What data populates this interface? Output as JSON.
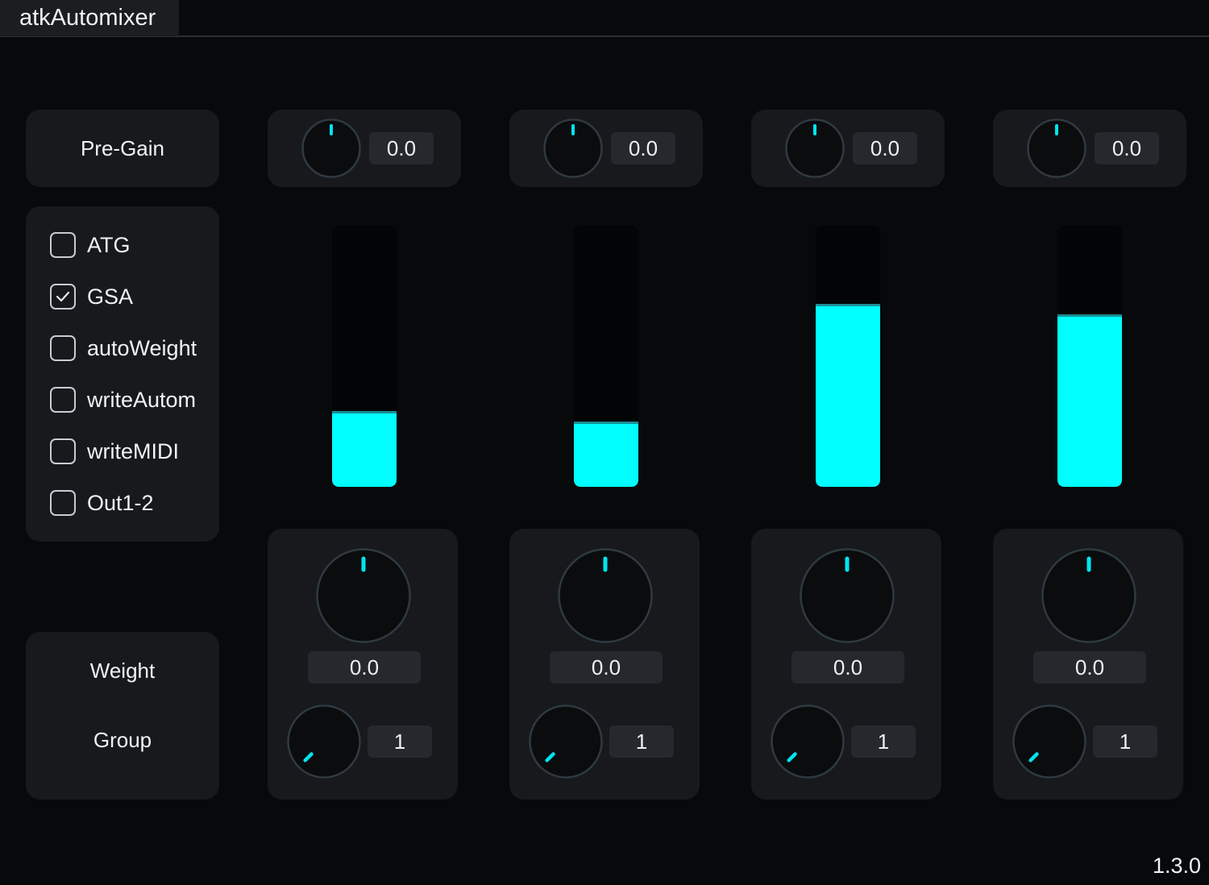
{
  "window": {
    "title": "atkAutomixer"
  },
  "labels": {
    "pregain": "Pre-Gain",
    "weight": "Weight",
    "group": "Group"
  },
  "options": [
    {
      "label": "ATG",
      "checked": false
    },
    {
      "label": "GSA",
      "checked": true
    },
    {
      "label": "autoWeight",
      "checked": false
    },
    {
      "label": "writeAutom",
      "checked": false
    },
    {
      "label": "writeMIDI",
      "checked": false
    },
    {
      "label": "Out1-2",
      "checked": false
    }
  ],
  "channels": [
    {
      "pregain": "0.0",
      "meter_level": 0.28,
      "weight": "0.0",
      "group": "1"
    },
    {
      "pregain": "0.0",
      "meter_level": 0.24,
      "weight": "0.0",
      "group": "1"
    },
    {
      "pregain": "0.0",
      "meter_level": 0.69,
      "weight": "0.0",
      "group": "1"
    },
    {
      "pregain": "0.0",
      "meter_level": 0.65,
      "weight": "0.0",
      "group": "1"
    }
  ],
  "colors": {
    "accent": "#00ffff",
    "panel": "#17191d",
    "background": "#08090b"
  },
  "version": "1.3.0"
}
